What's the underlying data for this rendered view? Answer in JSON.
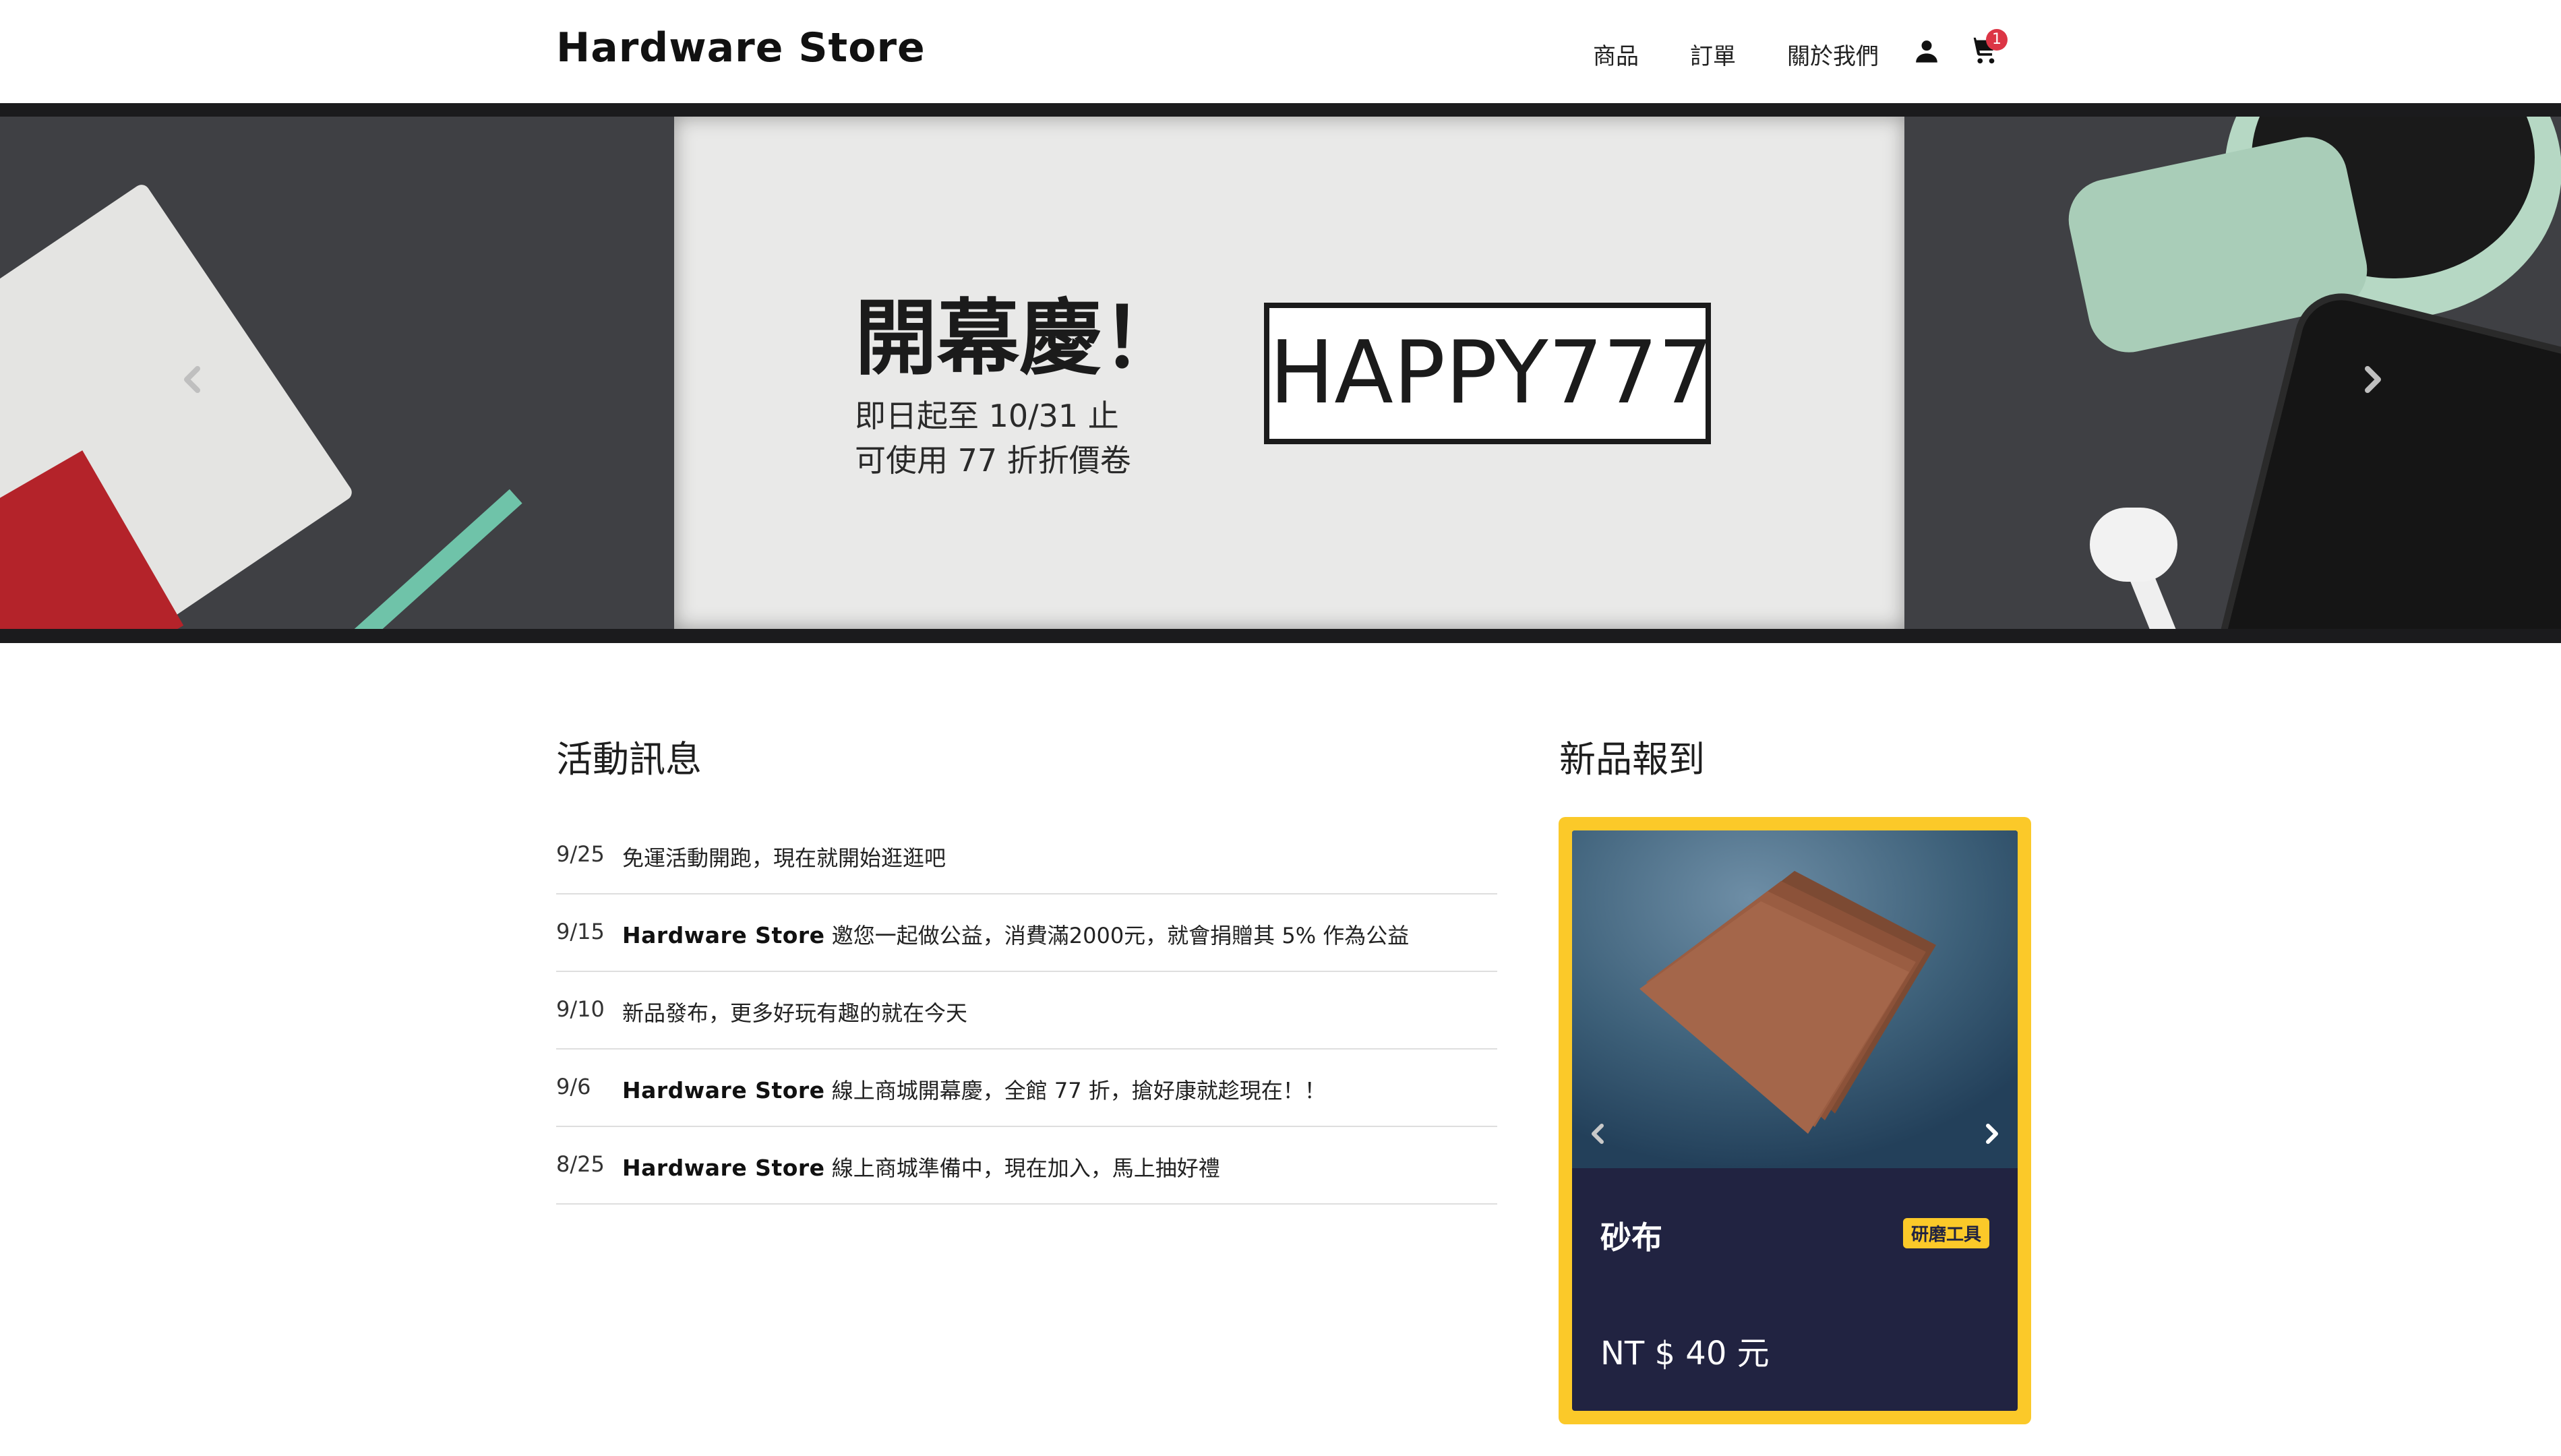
{
  "header": {
    "brand": "Hardware Store",
    "nav": [
      {
        "label": "商品"
      },
      {
        "label": "訂單"
      },
      {
        "label": "關於我們"
      }
    ],
    "icons": [
      "user-icon",
      "cart-icon"
    ],
    "cart_count": "1"
  },
  "hero": {
    "title": "開幕慶！",
    "line1": "即日起至 10/31 止",
    "line2": "可使用 77 折折價卷",
    "coupon_code": "HAPPY777",
    "prev_icon": "chevron-left-icon",
    "next_icon": "chevron-right-icon"
  },
  "news": {
    "title": "活動訊息",
    "items": [
      {
        "date": "9/25",
        "brand": "",
        "text": "免運活動開跑，現在就開始逛逛吧"
      },
      {
        "date": "9/15",
        "brand": "Hardware Store",
        "text": " 邀您一起做公益，消費滿2000元，就會捐贈其 5% 作為公益"
      },
      {
        "date": "9/10",
        "brand": "",
        "text": "新品發布，更多好玩有趣的就在今天"
      },
      {
        "date": "9/6",
        "brand": "Hardware Store",
        "text": " 線上商城開幕慶，全館 77 折，搶好康就趁現在！！"
      },
      {
        "date": "8/25",
        "brand": "Hardware Store",
        "text": " 線上商城準備中，現在加入，馬上抽好禮"
      }
    ]
  },
  "new_products": {
    "title": "新品報到",
    "product": {
      "name": "砂布",
      "tag": "研磨工具",
      "price": "NT $ 40 元"
    }
  },
  "colors": {
    "accent_yellow": "#fbc929",
    "card_navy": "#212341",
    "badge_red": "#dc3545"
  }
}
